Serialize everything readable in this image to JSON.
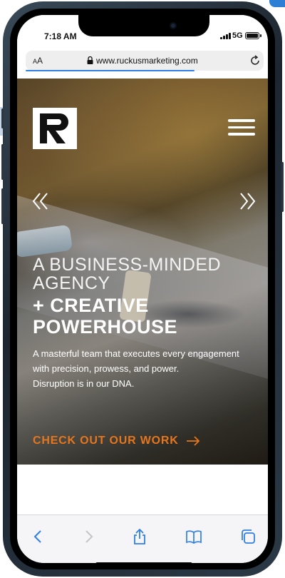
{
  "status_bar": {
    "time": "7:18 AM",
    "network": "5G",
    "battery_level": 1.0
  },
  "browser": {
    "text_size_label": "AA",
    "url": "www.ruckusmarketing.com",
    "page_load_progress": 0.71
  },
  "hero": {
    "headline_line1": "A Business-Minded",
    "headline_line2": "Agency",
    "headline_bold1": "+ Creative",
    "headline_bold2": "Powerhouse",
    "body_line1": "A masterful team that executes every engagement with precision, prowess, and power.",
    "body_line2": "Disruption is in our DNA.",
    "cta_label": "Check out our work"
  },
  "icons": {
    "logo": "ruckus-r-logo",
    "menu": "hamburger-menu-icon",
    "prev": "chevron-double-left-icon",
    "next": "chevron-double-right-icon",
    "cta_arrow": "arrow-right-icon",
    "toolbar": [
      "back-icon",
      "forward-icon",
      "share-icon",
      "bookmarks-icon",
      "tabs-icon"
    ]
  },
  "colors": {
    "accent": "#e5761e",
    "link_blue": "#2f7fe4",
    "text_white": "#ffffff"
  }
}
